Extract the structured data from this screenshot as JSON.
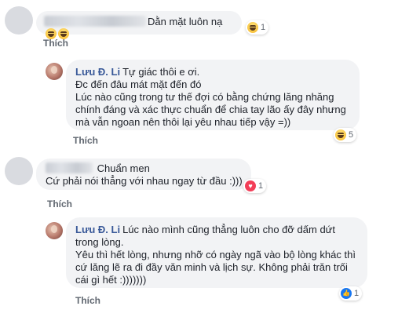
{
  "comments": [
    {
      "author": "",
      "author_hidden": true,
      "lines": [
        "Dằn mặt luôn nạ"
      ],
      "inline_emojis": [
        "grinning-face",
        "grinning-face"
      ],
      "action": "Thích",
      "reaction": {
        "icon": "haha-icon",
        "count": "1"
      }
    },
    {
      "author": "Lưu Đ. Li",
      "author_hidden": false,
      "lines": [
        "Tự giác thôi e ơi.",
        "Đc đến đâu mát mặt đến đó",
        "Lúc nào cũng trong tư thế đợi có bằng chứng lăng nhăng",
        "chính đáng và xác thực chuẩn để chia tay lão ấy đây nhưng",
        "mà vẫn ngoan nên thôi lại yêu nhau tiếp vậy =))"
      ],
      "action": "Thích",
      "reaction": {
        "icon": "haha-icon",
        "count": "5"
      }
    },
    {
      "author": "",
      "author_hidden": true,
      "lines": [
        "Chuẩn men",
        "Cứ phải nói thẳng với nhau ngay từ đầu :)))"
      ],
      "action": "Thích",
      "reaction": {
        "icon": "love-icon",
        "count": "1"
      }
    },
    {
      "author": "Lưu Đ. Li",
      "author_hidden": false,
      "lines": [
        "Lúc nào mình cũng thẳng luôn cho đỡ dấm dứt",
        "trong lòng.",
        "Yêu thì hết lòng, nhưng nhỡ có ngày ngã vào bộ lòng khác thì",
        "cứ lăng lẽ ra đi đầy văn minh và lịch sự. Không phải trăn trối",
        "cái gì hết :)))))))"
      ],
      "action": "Thích",
      "reaction": {
        "icon": "like-icon",
        "count": "1"
      }
    }
  ],
  "colors": {
    "bubble": "#f2f3f5",
    "name": "#385898",
    "action": "#606770"
  }
}
